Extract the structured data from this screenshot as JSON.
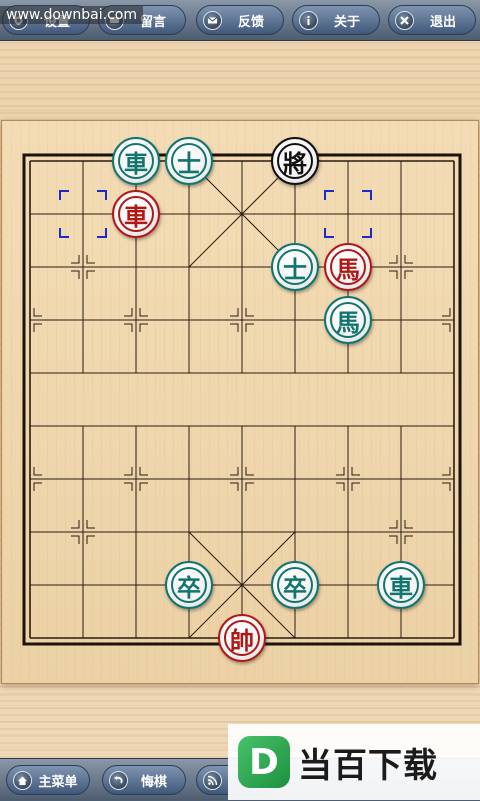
{
  "watermark": "www.downbai.com",
  "toolbar": {
    "buttons": [
      {
        "label": "设置",
        "icon": "gear-icon"
      },
      {
        "label": "留言",
        "icon": "comment-icon"
      },
      {
        "label": "反馈",
        "icon": "mail-icon"
      },
      {
        "label": "关于",
        "icon": "info-icon"
      },
      {
        "label": "退出",
        "icon": "close-icon"
      }
    ]
  },
  "bottombar": {
    "buttons": [
      {
        "label": "主菜单",
        "icon": "home-icon"
      },
      {
        "label": "悔棋",
        "icon": "undo-icon"
      },
      {
        "label": "",
        "icon": "rss-icon"
      }
    ]
  },
  "logo": {
    "mark": "D",
    "text": "当百下载"
  },
  "board": {
    "files": 9,
    "ranks": 10,
    "colors": {
      "red": "#b01818",
      "teal": "#10756e",
      "black": "#111111"
    },
    "selection_markers": [
      {
        "file": 1,
        "rank": 1
      },
      {
        "file": 6,
        "rank": 1
      }
    ],
    "pieces": [
      {
        "char": "車",
        "side": "teal",
        "file": 2,
        "rank": 0
      },
      {
        "char": "士",
        "side": "teal",
        "file": 3,
        "rank": 0
      },
      {
        "char": "將",
        "side": "black",
        "file": 5,
        "rank": 0
      },
      {
        "char": "車",
        "side": "red",
        "file": 2,
        "rank": 1
      },
      {
        "char": "士",
        "side": "teal",
        "file": 5,
        "rank": 2
      },
      {
        "char": "馬",
        "side": "red",
        "file": 6,
        "rank": 2
      },
      {
        "char": "馬",
        "side": "teal",
        "file": 6,
        "rank": 3
      },
      {
        "char": "卒",
        "side": "teal",
        "file": 3,
        "rank": 8
      },
      {
        "char": "卒",
        "side": "teal",
        "file": 5,
        "rank": 8
      },
      {
        "char": "車",
        "side": "teal",
        "file": 7,
        "rank": 8
      },
      {
        "char": "帥",
        "side": "red",
        "file": 4,
        "rank": 9
      }
    ]
  }
}
